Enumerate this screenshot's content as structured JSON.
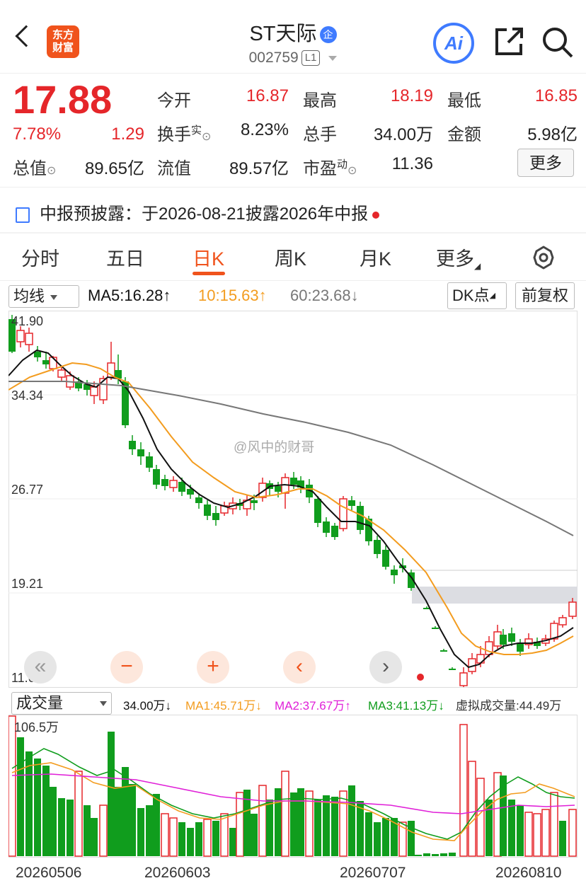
{
  "header": {
    "logo_line1": "东方",
    "logo_line2": "财富",
    "stock_name": "ST天际",
    "badge": "企",
    "stock_code": "002759",
    "level": "L1",
    "ai_label": "Ai",
    "icons": [
      "back-icon",
      "share-icon",
      "search-icon"
    ]
  },
  "quote": {
    "price": "17.88",
    "change_pct": "7.78%",
    "change_amt": "1.29",
    "open_label": "今开",
    "open_value": "16.87",
    "high_label": "最高",
    "high_value": "18.19",
    "low_label": "最低",
    "low_value": "16.85",
    "turnover_label": "换手",
    "turnover_sup": "实",
    "turnover_value": "8.23%",
    "volume_label": "总手",
    "volume_value": "34.00万",
    "amount_label": "金额",
    "amount_value": "5.98亿",
    "mktcap_label": "总值",
    "mktcap_value": "89.65亿",
    "float_label": "流值",
    "float_value": "89.57亿",
    "pe_label": "市盈",
    "pe_sup": "动",
    "pe_value": "11.36",
    "more_label": "更多"
  },
  "notice": {
    "text": "中报预披露：于2026-08-21披露2026年中报"
  },
  "tabs": [
    "分时",
    "五日",
    "日K",
    "周K",
    "月K",
    "更多"
  ],
  "active_tab": "日K",
  "kline": {
    "indicator_select": "均线",
    "ma5": "MA5:16.28↑",
    "ma10": "10:15.63↑",
    "ma60": "60:23.68↓",
    "dk_label": "DK点",
    "adjust_label": "前复权",
    "y_labels": [
      "41.90",
      "34.34",
      "26.77",
      "19.21",
      "11.64"
    ],
    "watermark": "@风中的财哥",
    "controls": [
      "«",
      "−",
      "+",
      "‹",
      "›"
    ]
  },
  "volume": {
    "indicator_select": "成交量",
    "vol": "34.00万↓",
    "ma1": "MA1:45.71万↓",
    "ma2": "MA2:37.67万↑",
    "ma3": "MA3:41.13万↓",
    "virtual": "虚拟成交量:44.49万",
    "max_label": "106.5万",
    "dates": [
      "20260506",
      "20260603",
      "20260707",
      "20260810"
    ]
  },
  "colors": {
    "up": "#e5262a",
    "down": "#109d1d",
    "accent": "#f0531c",
    "ma5": "#111111",
    "ma10": "#f39c1f",
    "ma60": "#777777",
    "vma2": "#e020d8"
  }
}
